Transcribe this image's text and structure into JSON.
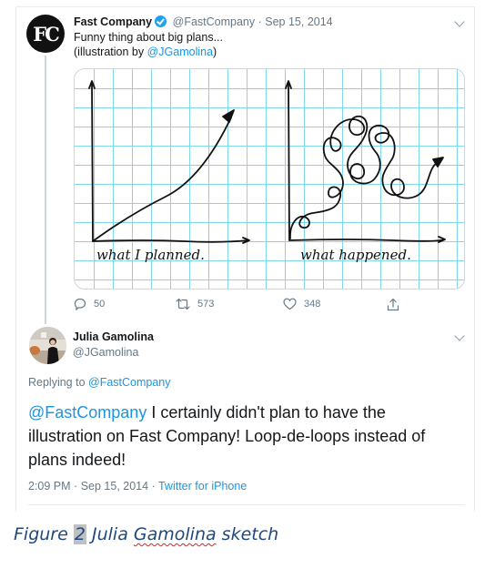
{
  "tweet": {
    "avatar_initials": "FC",
    "author_name": "Fast Company",
    "verified": true,
    "handle": "@FastCompany",
    "separator": "·",
    "date": "Sep 15, 2014",
    "text_line1": "Funny thing about big plans...",
    "text_line2_prefix": "(illustration by ",
    "text_line2_mention": "@JGamolina",
    "text_line2_suffix": ")",
    "image": {
      "left_label": "what I planned.",
      "right_label": "what happened."
    },
    "actions": {
      "replies": "50",
      "retweets": "573",
      "likes": "348"
    }
  },
  "reply": {
    "author_name": "Julia Gamolina",
    "handle": "@JGamolina",
    "replying_prefix": "Replying to ",
    "replying_mention": "@FastCompany",
    "text_mention": "@FastCompany",
    "text_body": " I certainly didn't plan to have the illustration on Fast Company! Loop-de-loops instead of plans indeed!",
    "time": "2:09 PM",
    "date": "Sep 15, 2014",
    "separator": "·",
    "source": "Twitter for iPhone"
  },
  "caption": {
    "prefix": "Figure ",
    "number": "2",
    "name_first": " Julia ",
    "name_last": "Gamolina",
    "suffix": " sketch"
  },
  "colors": {
    "link": "#1b95e0",
    "verified": "#1da1f2",
    "muted": "#657786",
    "grid": "#7fd8ee",
    "caption": "#1f497d"
  }
}
